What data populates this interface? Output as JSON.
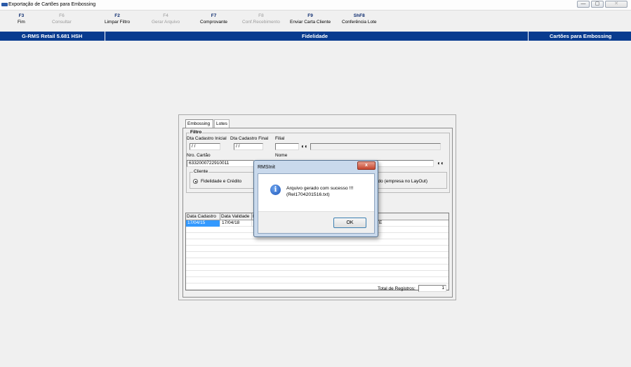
{
  "window": {
    "title": "Exportação de Cartões para Embossing",
    "buttons": [
      "—",
      "▢",
      "✕"
    ]
  },
  "toolbar": [
    {
      "key": "F3",
      "label": "Fim",
      "enabled": true
    },
    {
      "key": "F6",
      "label": "Consultar",
      "enabled": false
    },
    {
      "key": "F2",
      "label": "Limpar Filtro",
      "enabled": true
    },
    {
      "key": "F4",
      "label": "Gerar Arquivo",
      "enabled": false
    },
    {
      "key": "F7",
      "label": "Comprovante",
      "enabled": true
    },
    {
      "key": "F8",
      "label": "Conf.Recebimento",
      "enabled": false
    },
    {
      "key": "F9",
      "label": "Enviar Carta Cliente",
      "enabled": true
    },
    {
      "key": "ShF8",
      "label": "Conferência Lote",
      "enabled": true
    }
  ],
  "status_bar": {
    "left": "G-RMS Retail 5.681 HSH",
    "center": "Fidelidade",
    "right": "Cartões para Embossing"
  },
  "tabs": [
    "Embossing",
    "Lotes"
  ],
  "filter": {
    "group_title": "Filtro",
    "dta_inicial_label": "Dta Cadastro Inicial",
    "dta_inicial_value": " / /",
    "dta_final_label": "Dta Cadastro Final",
    "dta_final_value": " / /",
    "filial_label": "Filial",
    "filial_value": "",
    "nro_cartao_label": "Nro. Cartão",
    "nro_cartao_value": "6332000722910011",
    "nome_label": "Nome",
    "nome_value": "",
    "cliente_group": "Cliente",
    "radio_label": "Fidelidade e Crédito",
    "extra_label": "enciado (empresa no LayOut)"
  },
  "grid": {
    "headers": [
      "Data Cadastro",
      "Data Validade",
      "N",
      "",
      ""
    ],
    "rows": [
      {
        "data_cadastro": "17/04/15",
        "data_validade": "17/04/18",
        "extra": "ENTE"
      }
    ]
  },
  "total": {
    "label": "Total de Registros:",
    "value": "1"
  },
  "dialog": {
    "title": "RMSInit",
    "close": "x",
    "message_line1": "Arquivo gerado com sucesso !!!",
    "message_line2": "(Rel1704201516.txt)",
    "ok_label": "OK",
    "icon": "info-icon"
  }
}
